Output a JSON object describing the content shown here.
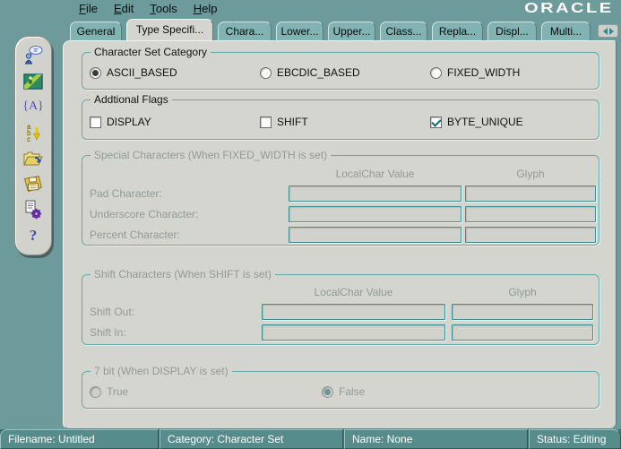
{
  "menu": {
    "items": [
      "File",
      "Edit",
      "Tools",
      "Help"
    ],
    "logo": "ORACLE"
  },
  "tabs": {
    "items": [
      {
        "label": "General",
        "active": false
      },
      {
        "label": "Type Specifi...",
        "active": true
      },
      {
        "label": "Chara...",
        "active": false
      },
      {
        "label": "Lower...",
        "active": false
      },
      {
        "label": "Upper...",
        "active": false
      },
      {
        "label": "Class...",
        "active": false
      },
      {
        "label": "Repla...",
        "active": false
      },
      {
        "label": "Displ...",
        "active": false
      },
      {
        "label": "Multi...",
        "active": false
      }
    ]
  },
  "toolbar": {
    "icons": [
      {
        "name": "new-language-wizard-icon"
      },
      {
        "name": "view-locale-map-icon"
      },
      {
        "name": "character-set-icon",
        "glyph": "{A}"
      },
      {
        "name": "linguistic-sort-icon",
        "letters": "abc"
      },
      {
        "name": "open-file-icon"
      },
      {
        "name": "save-file-icon"
      },
      {
        "name": "generate-nlb-icon"
      },
      {
        "name": "help-icon",
        "glyph": "?"
      }
    ]
  },
  "content": {
    "category": {
      "legend": "Character Set Category",
      "options": [
        {
          "label": "ASCII_BASED",
          "selected": true
        },
        {
          "label": "EBCDIC_BASED",
          "selected": false
        },
        {
          "label": "FIXED_WIDTH",
          "selected": false
        }
      ]
    },
    "flags": {
      "legend": "Addtional Flags",
      "options": [
        {
          "label": "DISPLAY",
          "checked": false
        },
        {
          "label": "SHIFT",
          "checked": false
        },
        {
          "label": "BYTE_UNIQUE",
          "checked": true
        }
      ]
    },
    "special": {
      "legend": "Special Characters (When FIXED_WIDTH is set)",
      "col1": "LocalChar Value",
      "col2": "Glyph",
      "rows": [
        {
          "label": "Pad Character:",
          "localchar": "",
          "glyph": ""
        },
        {
          "label": "Underscore Character:",
          "localchar": "",
          "glyph": ""
        },
        {
          "label": "Percent Character:",
          "localchar": "",
          "glyph": ""
        }
      ],
      "enabled": false
    },
    "shift": {
      "legend": "Shift Characters (When SHIFT is set)",
      "col1": "LocalChar Value",
      "col2": "Glyph",
      "rows": [
        {
          "label": "Shift Out:",
          "localchar": "",
          "glyph": ""
        },
        {
          "label": "Shift In:",
          "localchar": "",
          "glyph": ""
        }
      ],
      "enabled": false
    },
    "seven_bit": {
      "legend": "7 bit (When DISPLAY is set)",
      "options": [
        {
          "label": "True",
          "selected": false
        },
        {
          "label": "False",
          "selected": true
        }
      ],
      "enabled": false
    }
  },
  "statusbar": {
    "filename": "Filename: Untitled",
    "category": "Category: Character Set",
    "name": "Name: None",
    "status": "Status: Editing"
  },
  "colors": {
    "teal_background": "#6d9a9a",
    "tab_teal": "#82b3b3",
    "panel_gray": "#d5d5cf",
    "group_border_teal": "#63a8aa",
    "status_bar_teal": "#578c8c",
    "check_teal": "#17696b",
    "disabled_text": "#8f9b97"
  }
}
